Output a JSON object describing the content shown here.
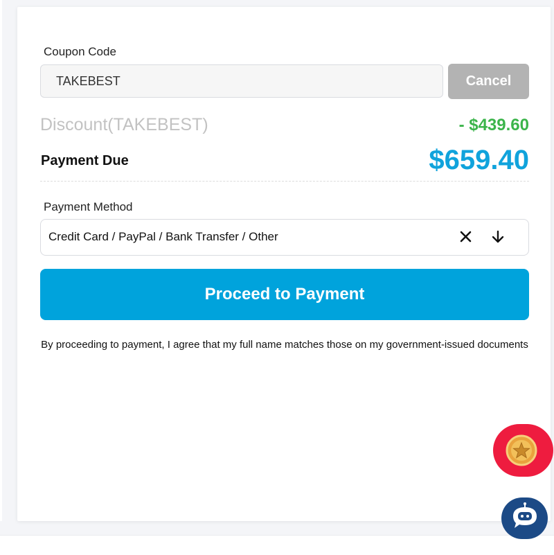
{
  "coupon": {
    "label": "Coupon Code",
    "value": "TAKEBEST",
    "cancel_label": "Cancel"
  },
  "summary": {
    "discount_label": "Discount(TAKEBEST)",
    "discount_value": "- $439.60",
    "due_label": "Payment Due",
    "due_value": "$659.40"
  },
  "payment_method": {
    "label": "Payment Method",
    "selected": "Credit Card / PayPal / Bank Transfer / Other"
  },
  "actions": {
    "proceed_label": "Proceed to Payment"
  },
  "disclaimer": "By proceeding to payment, I agree that my full name matches those on my government-issued documents",
  "floating": {
    "reward_icon": "star-coin-icon",
    "chat_icon": "robot-chat-icon"
  },
  "colors": {
    "accent": "#00a3dc",
    "due": "#10a3dc",
    "discount": "#3bb44a",
    "cancel": "#b3b3b3",
    "reward": "#ee1c3f",
    "chat": "#1c4a86"
  }
}
